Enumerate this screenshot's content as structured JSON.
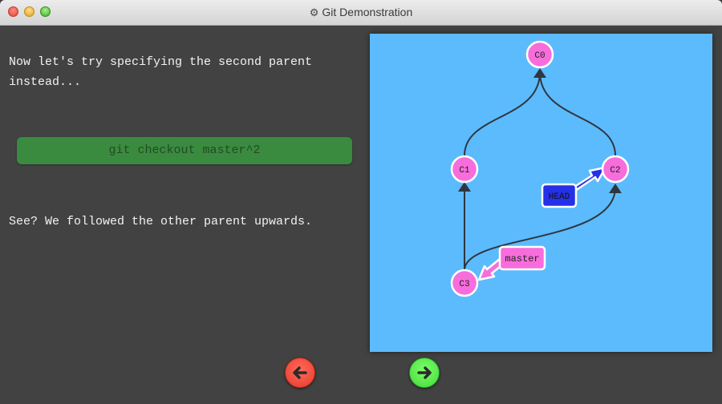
{
  "window": {
    "title": "Git Demonstration",
    "title_icon": "gear-icon"
  },
  "tutorial": {
    "intro_text": "Now let's try specifying the second parent instead...",
    "command": "git checkout master^2",
    "result_text": "See? We followed the other parent upwards."
  },
  "graph": {
    "commits": [
      "C0",
      "C1",
      "C2",
      "C3"
    ],
    "head_label": "HEAD",
    "branch_label": "master",
    "colors": {
      "background": "#5cbbfc",
      "commit": "#f86ddc",
      "head": "#2630e8",
      "branch": "#f86ddc"
    }
  },
  "nav": {
    "back_icon": "arrow-left-icon",
    "forward_icon": "arrow-right-icon"
  }
}
